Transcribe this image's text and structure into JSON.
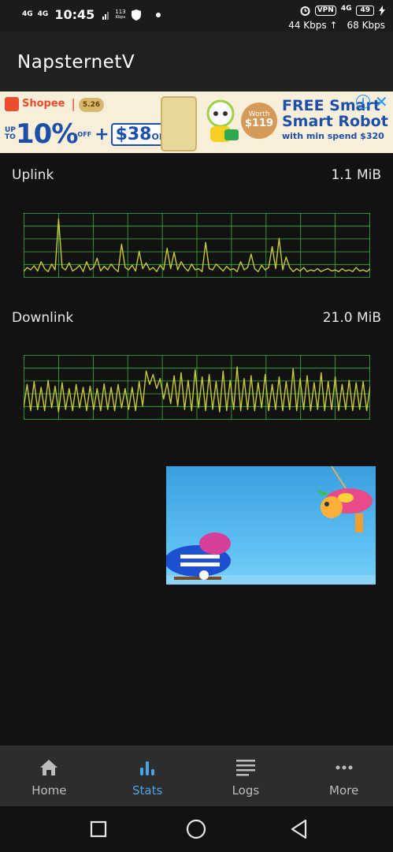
{
  "status_bar": {
    "signal_1": "4G",
    "signal_2": "4G",
    "time": "10:45",
    "speed_small_value": "113",
    "speed_small_unit": "Kbps",
    "vpn_label": "VPN",
    "network_type": "4G",
    "battery_level": "49",
    "upload_speed": "44 Kbps",
    "download_speed": "68 Kbps",
    "icons": [
      "shield-icon",
      "alarm-icon",
      "charging-icon"
    ]
  },
  "app_bar": {
    "title": "NapsternetV"
  },
  "ad_banner": {
    "brand": "Shopee",
    "badge": "5.26",
    "upto": "UP TO",
    "percent": "10%",
    "percent_suffix": "OFF",
    "plus": "+",
    "cashback": "$38",
    "cashback_suffix": "OFF*",
    "worth_label": "Worth",
    "worth_value": "$119",
    "headline_line1": "FREE Smart",
    "headline_line2": "Smart Robot",
    "subline": "with min spend $320",
    "info_icon": "info-icon",
    "close_icon": "close-icon"
  },
  "stats": {
    "uplink": {
      "label": "Uplink",
      "value": "1.1 MiB"
    },
    "downlink": {
      "label": "Downlink",
      "value": "21.0 MiB"
    },
    "graph_color": "#c8c83c",
    "grid_color": "#3cb43c"
  },
  "chart_data": [
    {
      "type": "line",
      "xlabel": "",
      "ylabel": "",
      "ylim": [
        0,
        1
      ],
      "values": [
        0.05,
        0.12,
        0.08,
        0.15,
        0.06,
        0.22,
        0.1,
        0.05,
        0.18,
        0.08,
        0.95,
        0.12,
        0.08,
        0.2,
        0.06,
        0.1,
        0.16,
        0.05,
        0.22,
        0.08,
        0.12,
        0.28,
        0.06,
        0.14,
        0.08,
        0.18,
        0.1,
        0.05,
        0.52,
        0.12,
        0.08,
        0.16,
        0.06,
        0.4,
        0.1,
        0.2,
        0.08,
        0.12,
        0.05,
        0.16,
        0.08,
        0.45,
        0.1,
        0.38,
        0.08,
        0.22,
        0.12,
        0.06,
        0.18,
        0.08,
        0.1,
        0.05,
        0.55,
        0.1,
        0.08,
        0.18,
        0.12,
        0.06,
        0.14,
        0.08,
        0.1,
        0.05,
        0.22,
        0.08,
        0.12,
        0.35,
        0.1,
        0.05,
        0.16,
        0.08,
        0.12,
        0.48,
        0.1,
        0.62,
        0.08,
        0.3,
        0.12,
        0.05,
        0.1,
        0.06,
        0.12,
        0.05,
        0.08,
        0.06,
        0.1,
        0.05,
        0.08,
        0.1,
        0.06,
        0.08,
        0.05,
        0.1,
        0.06,
        0.08,
        0.05,
        0.12,
        0.06,
        0.08,
        0.05,
        0.1
      ]
    },
    {
      "type": "line",
      "xlabel": "",
      "ylabel": "",
      "ylim": [
        0,
        1
      ],
      "values": [
        0.15,
        0.55,
        0.1,
        0.6,
        0.12,
        0.5,
        0.1,
        0.62,
        0.15,
        0.52,
        0.08,
        0.58,
        0.12,
        0.48,
        0.1,
        0.55,
        0.15,
        0.5,
        0.1,
        0.52,
        0.12,
        0.48,
        0.1,
        0.56,
        0.12,
        0.5,
        0.1,
        0.55,
        0.15,
        0.48,
        0.12,
        0.5,
        0.1,
        0.6,
        0.18,
        0.78,
        0.55,
        0.72,
        0.48,
        0.65,
        0.3,
        0.58,
        0.22,
        0.7,
        0.18,
        0.75,
        0.12,
        0.62,
        0.1,
        0.8,
        0.15,
        0.68,
        0.1,
        0.72,
        0.12,
        0.6,
        0.08,
        0.78,
        0.1,
        0.62,
        0.12,
        0.85,
        0.1,
        0.65,
        0.12,
        0.7,
        0.1,
        0.58,
        0.15,
        0.72,
        0.1,
        0.55,
        0.12,
        0.68,
        0.1,
        0.6,
        0.12,
        0.82,
        0.1,
        0.65,
        0.12,
        0.7,
        0.1,
        0.58,
        0.12,
        0.75,
        0.1,
        0.6,
        0.12,
        0.68,
        0.1,
        0.55,
        0.12,
        0.62,
        0.1,
        0.58,
        0.12,
        0.6,
        0.1,
        0.52
      ]
    }
  ],
  "bottom_nav": {
    "items": [
      {
        "label": "Home",
        "icon": "home-icon",
        "active": false
      },
      {
        "label": "Stats",
        "icon": "stats-icon",
        "active": true
      },
      {
        "label": "Logs",
        "icon": "logs-icon",
        "active": false
      },
      {
        "label": "More",
        "icon": "more-icon",
        "active": false
      }
    ],
    "active_color": "#4aa3e6",
    "inactive_color": "#bdbdbd"
  },
  "system_nav": {
    "recents_icon": "square-icon",
    "home_icon": "circle-icon",
    "back_icon": "triangle-back-icon"
  }
}
